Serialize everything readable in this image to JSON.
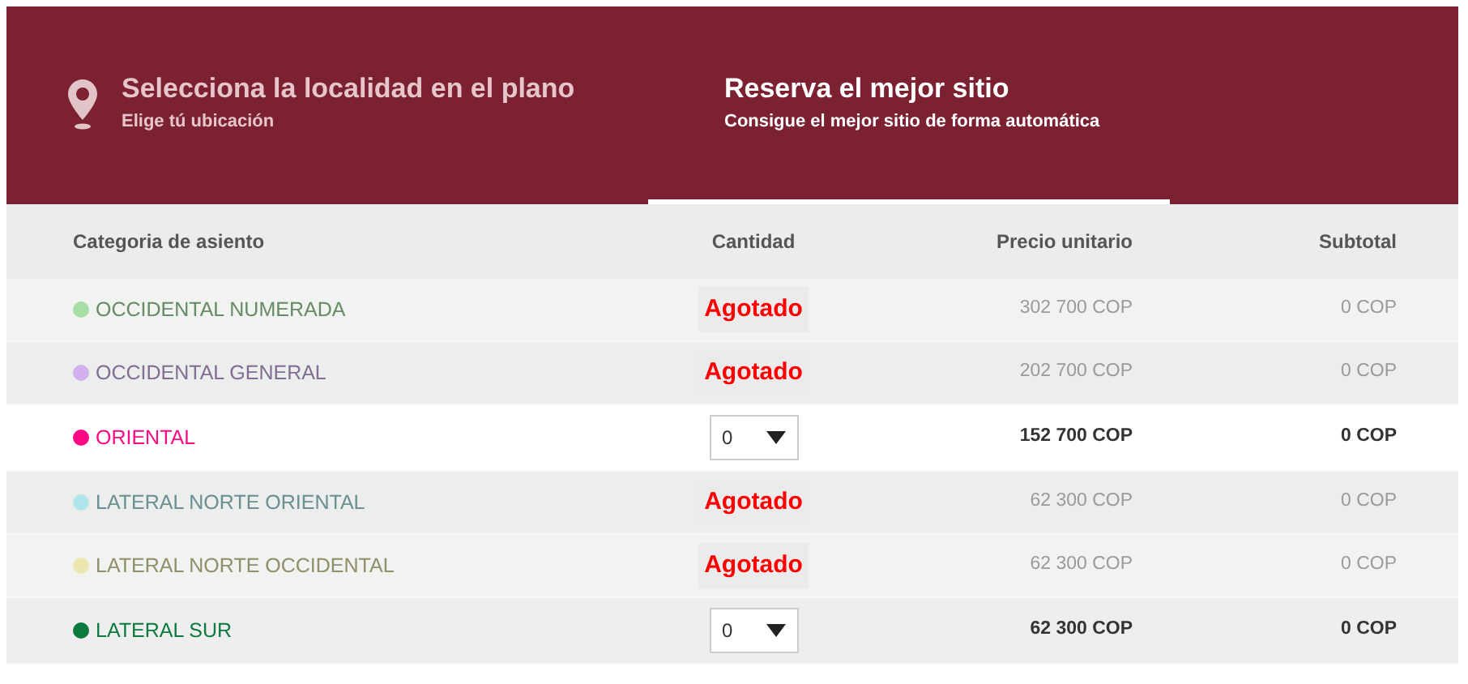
{
  "tabs": [
    {
      "kind": "map",
      "title": "Selecciona la localidad en el plano",
      "subtitle": "Elige tú ubicación",
      "selected": false
    },
    {
      "kind": "auto",
      "title": "Reserva el mejor sitio",
      "subtitle": "Consigue el mejor sitio de forma automática",
      "selected": true
    }
  ],
  "table": {
    "columns": [
      "Categoria de asiento",
      "Cantidad",
      "Precio unitario",
      "Subtotal"
    ],
    "rows": [
      {
        "kind": "sold_out",
        "name": "OCCIDENTAL NUMERADA",
        "color": "#a6dea6",
        "status": "Agotado",
        "price": "302 700 COP",
        "subtotal": "0 COP"
      },
      {
        "kind": "sold_out",
        "name": "OCCIDENTAL GENERAL",
        "color": "#d2b2ee",
        "status": "Agotado",
        "price": "202 700 COP",
        "subtotal": "0 COP"
      },
      {
        "kind": "available",
        "name": "ORIENTAL",
        "color": "#ff0a84",
        "quantity": "0",
        "price": "152 700 COP",
        "subtotal": "0 COP"
      },
      {
        "kind": "sold_out",
        "name": "LATERAL NORTE ORIENTAL",
        "color": "#aee6ea",
        "status": "Agotado",
        "price": "62 300 COP",
        "subtotal": "0 COP"
      },
      {
        "kind": "sold_out",
        "name": "LATERAL NORTE OCCIDENTAL",
        "color": "#eae6ae",
        "status": "Agotado",
        "price": "62 300 COP",
        "subtotal": "0 COP"
      },
      {
        "kind": "available",
        "name": "LATERAL SUR",
        "color": "#0b7a3e",
        "quantity": "0",
        "price": "62 300 COP",
        "subtotal": "0 COP"
      }
    ]
  }
}
